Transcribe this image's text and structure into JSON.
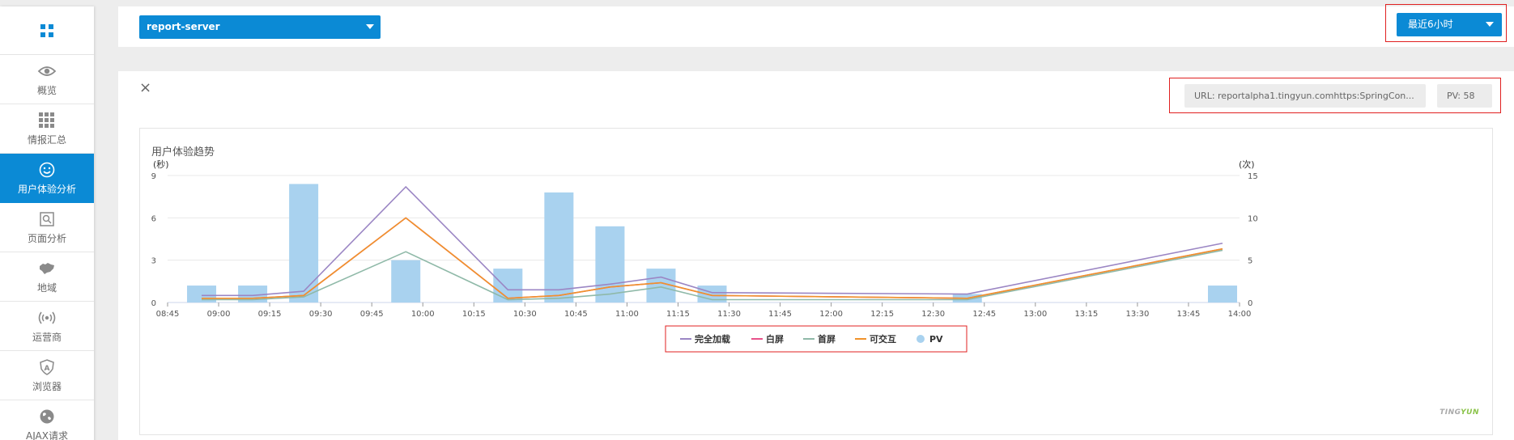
{
  "sidebar": {
    "items": [
      {
        "label": "概览",
        "icon": "eye-icon",
        "active": false
      },
      {
        "label": "情报汇总",
        "icon": "grid-icon",
        "active": false
      },
      {
        "label": "用户体验分析",
        "icon": "smile-icon",
        "active": true
      },
      {
        "label": "页面分析",
        "icon": "page-search-icon",
        "active": false
      },
      {
        "label": "地域",
        "icon": "map-icon",
        "active": false
      },
      {
        "label": "运营商",
        "icon": "signal-icon",
        "active": false
      },
      {
        "label": "浏览器",
        "icon": "shield-a-icon",
        "active": false
      },
      {
        "label": "AJAX请求",
        "icon": "globe-icon",
        "active": false
      }
    ]
  },
  "header": {
    "app_selector": "report-server",
    "time_range": "最近6小时"
  },
  "filters": {
    "url": "URL: reportalpha1.tingyun.comhttps:SpringCon...",
    "pv": "PV: 58"
  },
  "panel": {
    "close_label": "×",
    "chart_title": "用户体验趋势",
    "brand_prefix": "TING",
    "brand_suffix": "YUN"
  },
  "colors": {
    "accent": "#0b8ad5",
    "full_load": "#9b86c4",
    "white_screen": "#e8528a",
    "first_screen": "#8fb9a8",
    "interactive": "#f0922b",
    "pv": "#a9d2ef"
  },
  "chart_data": {
    "type": "bar+line",
    "left_unit": "(秒)",
    "right_unit": "(次)",
    "left_ticks": [
      0,
      3,
      6,
      9
    ],
    "right_ticks": [
      0,
      5,
      10,
      15
    ],
    "ylim": [
      0,
      9
    ],
    "y2lim": [
      0,
      15
    ],
    "x_ticks": [
      "08:45",
      "09:00",
      "09:15",
      "09:30",
      "09:45",
      "10:00",
      "10:15",
      "10:30",
      "10:45",
      "11:00",
      "11:15",
      "11:30",
      "11:45",
      "12:00",
      "12:15",
      "12:30",
      "12:45",
      "13:00",
      "13:15",
      "13:30",
      "13:45",
      "14:00"
    ],
    "time_points": [
      "08:55",
      "09:10",
      "09:25",
      "09:55",
      "10:25",
      "10:40",
      "10:55",
      "11:10",
      "11:25",
      "12:40",
      "13:55"
    ],
    "series": [
      {
        "name": "完全加载",
        "color": "#9b86c4",
        "values": [
          0.5,
          0.5,
          0.8,
          8.2,
          0.9,
          0.9,
          1.3,
          1.8,
          0.7,
          0.6,
          4.2
        ]
      },
      {
        "name": "白屏",
        "color": "#e8528a",
        "values": [
          0.3,
          0.3,
          0.5,
          6.0,
          0.3,
          0.5,
          1.1,
          1.4,
          0.5,
          0.3,
          3.8
        ]
      },
      {
        "name": "首屏",
        "color": "#8fb9a8",
        "values": [
          0.2,
          0.2,
          0.4,
          3.6,
          0.2,
          0.3,
          0.6,
          1.1,
          0.2,
          0.2,
          3.7
        ]
      },
      {
        "name": "可交互",
        "color": "#f0922b",
        "values": [
          0.3,
          0.3,
          0.5,
          6.0,
          0.3,
          0.5,
          1.1,
          1.4,
          0.5,
          0.3,
          3.8
        ]
      }
    ],
    "pv_series": {
      "name": "PV",
      "color": "#a9d2ef",
      "values": [
        2,
        2,
        14,
        5,
        4,
        13,
        9,
        4,
        2,
        1,
        2
      ]
    }
  }
}
